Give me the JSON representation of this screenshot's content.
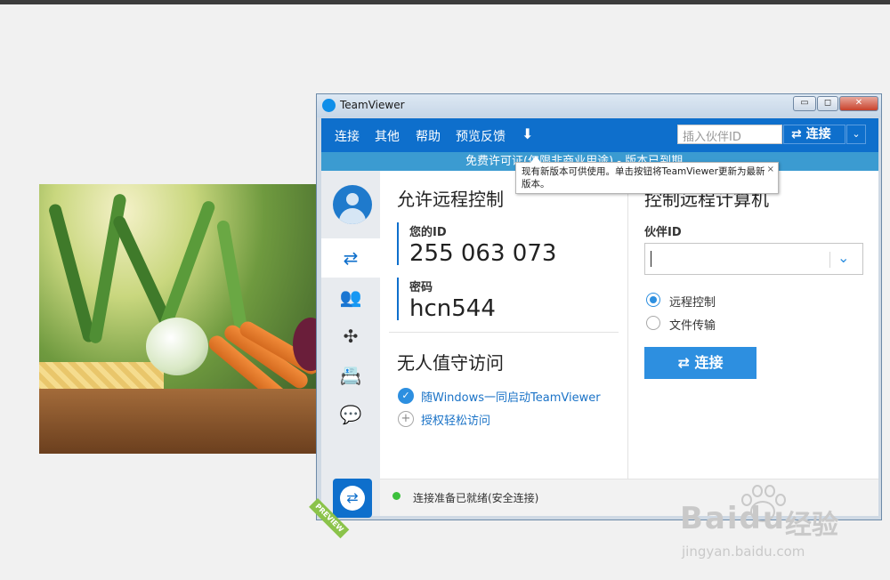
{
  "window": {
    "title": "TeamViewer",
    "min": "▭",
    "max": "◻",
    "close": "✕"
  },
  "menu": {
    "items": [
      "连接",
      "其他",
      "帮助",
      "预览反馈"
    ],
    "download_icon": "⬇",
    "partner_placeholder": "插入伙伴ID",
    "connect_label": "⇄ 连接",
    "connect_arrow": "⌄"
  },
  "license_text": "免费许可证(仅限非商业用途) - 版本已到期",
  "tooltip": {
    "text": "现有新版本可供使用。单击按钮将TeamViewer更新为最新版本。",
    "close": "×"
  },
  "left": {
    "allow_title": "允许远程控制",
    "id_label": "您的ID",
    "id_value": "255 063 073",
    "pw_label": "密码",
    "pw_value": "hcn544",
    "unattended_title": "无人值守访问",
    "opt_start": "随Windows一同启动TeamViewer",
    "opt_grant": "授权轻松访问"
  },
  "right": {
    "control_title": "控制远程计算机",
    "partner_label": "伙伴ID",
    "radio_remote": "远程控制",
    "radio_file": "文件传输",
    "connect_button": "⇄ 连接"
  },
  "sidebar": {
    "icons": [
      "⇄",
      "👥",
      "✣",
      "📇",
      "💬"
    ],
    "preview": "PREVIEW"
  },
  "status": "连接准备已就绪(安全连接)",
  "watermark": {
    "brand": "Bai",
    "brand2": "du",
    "cn": "经验",
    "url": "jingyan.baidu.com"
  }
}
